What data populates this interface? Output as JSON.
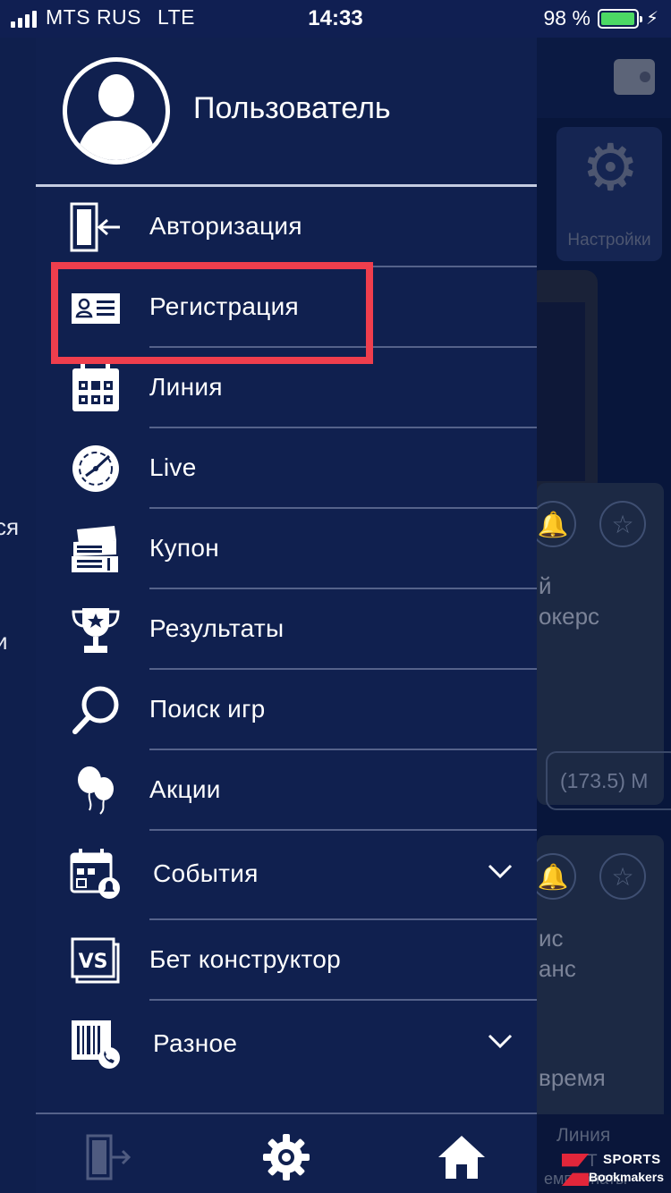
{
  "status_bar": {
    "carrier": "MTS RUS",
    "network": "LTE",
    "time": "14:33",
    "battery": "98 %",
    "battery_fraction": 0.98,
    "battery_color": "#4cd964"
  },
  "background_app": {
    "left_fragments": [
      "ся",
      "и"
    ],
    "settings_label": "Настройки",
    "cards": [
      {
        "lines": [
          "й",
          "окерс"
        ],
        "score": "(173.5) М"
      },
      {
        "lines": [
          "ис",
          "анс",
          "время"
        ]
      }
    ],
    "tab_label": "Линия",
    "tab_sublabel": "Т",
    "tab_sublabel_2": "емпионаты",
    "logo_line1": "SPORTS",
    "logo_line2": "Bookmakers"
  },
  "drawer": {
    "user_name": "Пользователь",
    "menu": [
      {
        "id": "auth",
        "label": "Авторизация",
        "icon": "login-door-icon"
      },
      {
        "id": "registration",
        "label": "Регистрация",
        "icon": "id-card-icon"
      },
      {
        "id": "line",
        "label": "Линия",
        "icon": "calendar-grid-icon"
      },
      {
        "id": "live",
        "label": "Live",
        "icon": "live-clock-icon"
      },
      {
        "id": "coupon",
        "label": "Купон",
        "icon": "tickets-icon"
      },
      {
        "id": "results",
        "label": "Результаты",
        "icon": "trophy-icon"
      },
      {
        "id": "search",
        "label": "Поиск игр",
        "icon": "magnifier-icon"
      },
      {
        "id": "promos",
        "label": "Акции",
        "icon": "balloons-icon"
      },
      {
        "id": "events",
        "label": "События",
        "icon": "calendar-bell-icon",
        "expandable": true
      },
      {
        "id": "bet_constructor",
        "label": "Бет конструктор",
        "icon": "versus-icon"
      },
      {
        "id": "misc",
        "label": "Разное",
        "icon": "barcode-phone-icon",
        "expandable": true
      }
    ],
    "footer": [
      "login-icon",
      "settings-gear-icon",
      "home-icon"
    ]
  },
  "colors": {
    "drawer_bg": "#10204f",
    "separator": "#55628a",
    "highlight": "#ef3e4d"
  }
}
